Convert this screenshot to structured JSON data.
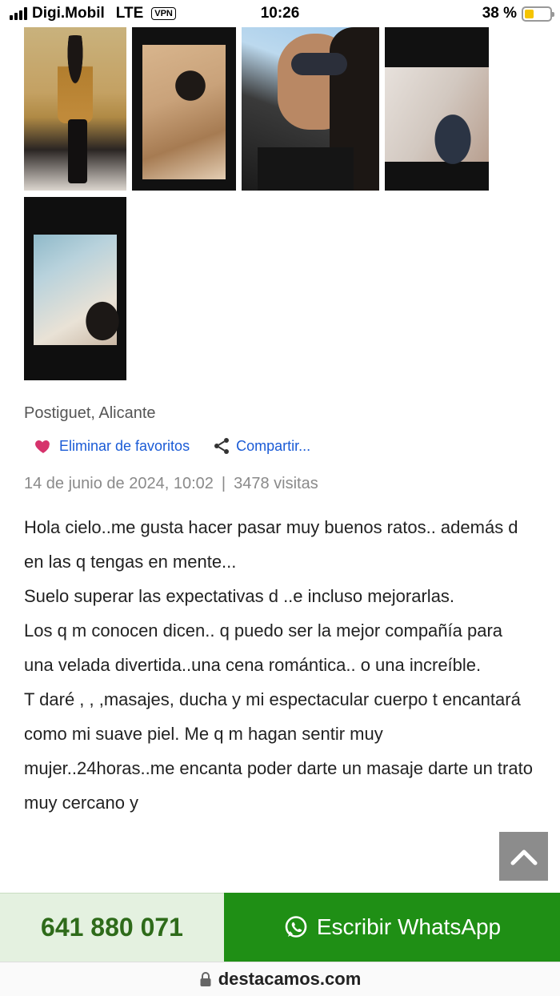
{
  "status_bar": {
    "carrier": "Digi.Mobil",
    "network": "LTE",
    "vpn": "VPN",
    "time": "10:26",
    "battery_percent": "38 %",
    "battery_level": 0.38
  },
  "photos": [
    {
      "name": "photo-1"
    },
    {
      "name": "photo-2"
    },
    {
      "name": "photo-3"
    },
    {
      "name": "photo-4"
    },
    {
      "name": "photo-5"
    }
  ],
  "listing": {
    "location": "Postiguet, Alicante",
    "favorite_label": "Eliminar de favoritos",
    "share_label": "Compartir...",
    "date": "14 de junio de 2024, 10:02",
    "separator": "|",
    "views": "3478 visitas",
    "description": [
      "Hola cielo..me gusta hacer pasar muy buenos ratos.. además d en las q tengas en mente...",
      "Suelo superar las expectativas d ..e incluso mejorarlas.",
      "Los q m conocen dicen.. q puedo ser la mejor compañía para una velada divertida..una cena romántica.. o una increíble.",
      "T daré , , ,masajes, ducha y mi espectacular cuerpo t encantará como mi suave piel. Me q m hagan sentir muy mujer..24horas..me encanta poder darte un masaje darte un trato muy cercano y"
    ]
  },
  "contact": {
    "phone": "641 880 071",
    "whatsapp_label": "Escribir WhatsApp"
  },
  "browser": {
    "domain": "destacamos.com"
  },
  "colors": {
    "link": "#1a5bd6",
    "heart": "#d6336c",
    "whatsapp_green": "#1f8f15",
    "phone_bg": "#e4f1e0",
    "phone_text": "#2e6b1a"
  }
}
